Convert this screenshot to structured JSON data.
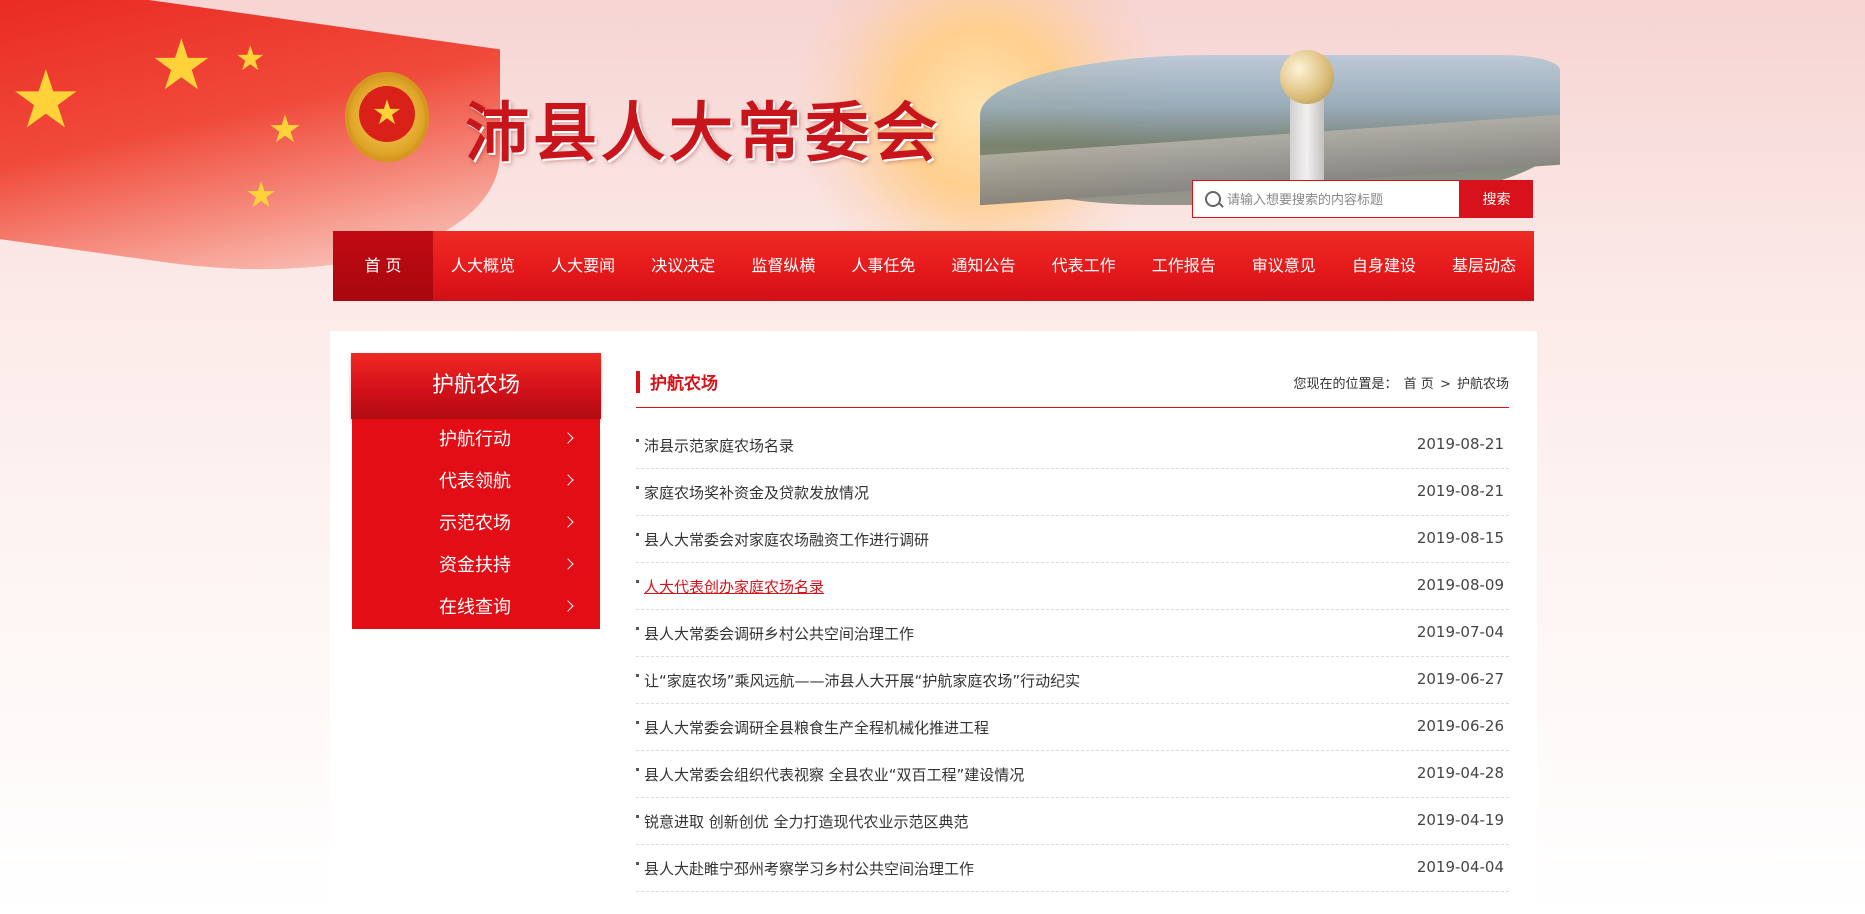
{
  "site": {
    "title": "沛县人大常委会"
  },
  "search": {
    "placeholder": "请输入想要搜索的内容标题",
    "button_label": "搜索"
  },
  "nav": {
    "items": [
      {
        "label": "首 页",
        "active": true
      },
      {
        "label": "人大概览"
      },
      {
        "label": "人大要闻"
      },
      {
        "label": "决议决定"
      },
      {
        "label": "监督纵横"
      },
      {
        "label": "人事任免"
      },
      {
        "label": "通知公告"
      },
      {
        "label": "代表工作"
      },
      {
        "label": "工作报告"
      },
      {
        "label": "审议意见"
      },
      {
        "label": "自身建设"
      },
      {
        "label": "基层动态"
      }
    ]
  },
  "sidebar": {
    "title": "护航农场",
    "items": [
      {
        "label": "护航行动"
      },
      {
        "label": "代表领航"
      },
      {
        "label": "示范农场"
      },
      {
        "label": "资金扶持"
      },
      {
        "label": "在线查询"
      }
    ]
  },
  "main": {
    "title": "护航农场",
    "breadcrumb": {
      "prefix": "您现在的位置是：",
      "home": "首 页",
      "separator": ">",
      "current": "护航农场"
    },
    "articles": [
      {
        "title": "沛县示范家庭农场名录",
        "date": "2019-08-21"
      },
      {
        "title": "家庭农场奖补资金及贷款发放情况",
        "date": "2019-08-21"
      },
      {
        "title": "县人大常委会对家庭农场融资工作进行调研",
        "date": "2019-08-15"
      },
      {
        "title": "人大代表创办家庭农场名录",
        "date": "2019-08-09",
        "highlighted": true
      },
      {
        "title": "县人大常委会调研乡村公共空间治理工作",
        "date": "2019-07-04"
      },
      {
        "title": "让“家庭农场”乘风远航——沛县人大开展“护航家庭农场”行动纪实",
        "date": "2019-06-27"
      },
      {
        "title": "县人大常委会调研全县粮食生产全程机械化推进工程",
        "date": "2019-06-26"
      },
      {
        "title": "县人大常委会组织代表视察 全县农业“双百工程”建设情况",
        "date": "2019-04-28"
      },
      {
        "title": "锐意进取 创新创优 全力打造现代农业示范区典范",
        "date": "2019-04-19"
      },
      {
        "title": "县人大赴睢宁邳州考察学习乡村公共空间治理工作",
        "date": "2019-04-04"
      }
    ]
  },
  "colors": {
    "brand_red": "#d7121a",
    "nav_active": "#b00a12",
    "link_hover": "#d7121a"
  },
  "icons": {
    "search": "search-icon",
    "chevron": "chevron-right-icon",
    "emblem": "national-emblem-icon"
  }
}
